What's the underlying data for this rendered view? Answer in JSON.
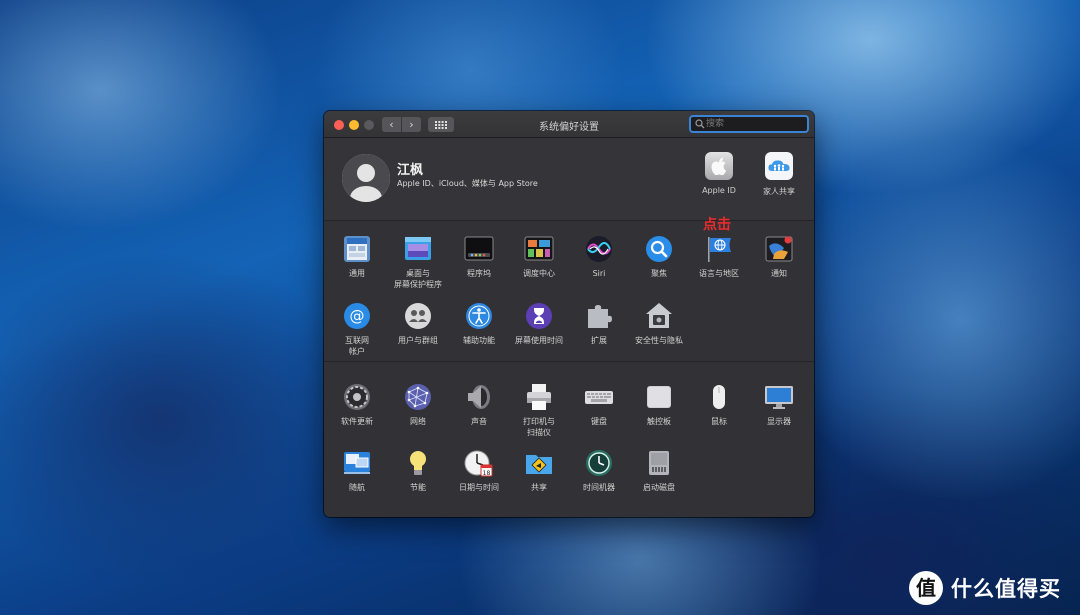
{
  "window": {
    "title": "系统偏好设置",
    "search_placeholder": "搜索"
  },
  "account": {
    "name": "江枫",
    "subtitle": "Apple ID、iCloud、媒体与 App Store",
    "items": [
      {
        "label": "Apple ID",
        "icon": "apple-id-icon"
      },
      {
        "label": "家人共享",
        "icon": "family-sharing-icon"
      }
    ]
  },
  "row1": [
    {
      "label": "通用",
      "icon": "general-icon"
    },
    {
      "label": "桌面与\n屏幕保护程序",
      "icon": "desktop-screensaver-icon"
    },
    {
      "label": "程序坞",
      "icon": "dock-icon"
    },
    {
      "label": "调度中心",
      "icon": "mission-control-icon"
    },
    {
      "label": "Siri",
      "icon": "siri-icon"
    },
    {
      "label": "聚焦",
      "icon": "spotlight-icon"
    },
    {
      "label": "语言与地区",
      "icon": "language-region-icon"
    },
    {
      "label": "通知",
      "icon": "notifications-icon"
    }
  ],
  "row2": [
    {
      "label": "互联网\n帐户",
      "icon": "internet-accounts-icon"
    },
    {
      "label": "用户与群组",
      "icon": "users-groups-icon"
    },
    {
      "label": "辅助功能",
      "icon": "accessibility-icon"
    },
    {
      "label": "屏幕使用时间",
      "icon": "screen-time-icon"
    },
    {
      "label": "扩展",
      "icon": "extensions-icon"
    },
    {
      "label": "安全性与隐私",
      "icon": "security-privacy-icon"
    }
  ],
  "row3": [
    {
      "label": "软件更新",
      "icon": "software-update-icon"
    },
    {
      "label": "网络",
      "icon": "network-icon"
    },
    {
      "label": "声音",
      "icon": "sound-icon"
    },
    {
      "label": "打印机与\n扫描仪",
      "icon": "printers-scanners-icon"
    },
    {
      "label": "键盘",
      "icon": "keyboard-icon"
    },
    {
      "label": "触控板",
      "icon": "trackpad-icon"
    },
    {
      "label": "鼠标",
      "icon": "mouse-icon"
    },
    {
      "label": "显示器",
      "icon": "displays-icon"
    }
  ],
  "row4": [
    {
      "label": "随航",
      "icon": "sidecar-icon"
    },
    {
      "label": "节能",
      "icon": "energy-saver-icon"
    },
    {
      "label": "日期与时间",
      "icon": "date-time-icon"
    },
    {
      "label": "共享",
      "icon": "sharing-icon"
    },
    {
      "label": "时间机器",
      "icon": "time-machine-icon"
    },
    {
      "label": "启动磁盘",
      "icon": "startup-disk-icon"
    }
  ],
  "annotation": "点击",
  "watermark": "什么值得买",
  "colors": {
    "window_bg": "#323236",
    "search_focus": "#3b83d6",
    "annotation": "#ee2b2b"
  }
}
